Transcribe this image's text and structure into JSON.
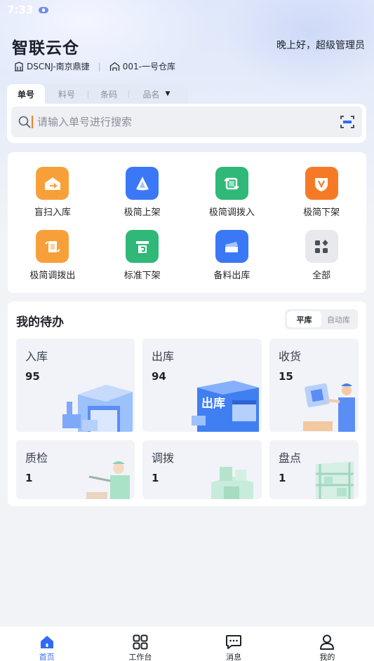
{
  "status_bar": {
    "time": "7:33"
  },
  "header": {
    "app_title": "智联云仓",
    "greeting": "晚上好，超级管理员",
    "company": "DSCNJ-南京鼎捷",
    "warehouse": "001-一号仓库"
  },
  "search": {
    "tabs": [
      {
        "label": "单号",
        "active": true
      },
      {
        "label": "料号",
        "active": false
      },
      {
        "label": "条码",
        "active": false
      },
      {
        "label": "品名",
        "active": false
      }
    ],
    "placeholder": "请输入单号进行搜索"
  },
  "quick_menu": [
    {
      "label": "盲扫入库",
      "icon": "blind-scan-inbound-icon",
      "color": "#f7a03a"
    },
    {
      "label": "极简上架",
      "icon": "simple-shelving-icon",
      "color": "#3a78f6"
    },
    {
      "label": "极简调拨入",
      "icon": "simple-transfer-in-icon",
      "color": "#2fb878"
    },
    {
      "label": "极简下架",
      "icon": "simple-unshelving-icon",
      "color": "#f67a26"
    },
    {
      "label": "极简调拨出",
      "icon": "simple-transfer-out-icon",
      "color": "#f7a03a"
    },
    {
      "label": "标准下架",
      "icon": "standard-unshelving-icon",
      "color": "#2fb878"
    },
    {
      "label": "备料出库",
      "icon": "material-outbound-icon",
      "color": "#3a78f6"
    },
    {
      "label": "全部",
      "icon": "all-apps-icon",
      "color": "#e8e9ed"
    }
  ],
  "todo": {
    "title": "我的待办",
    "segments": [
      {
        "label": "平库",
        "active": true
      },
      {
        "label": "自动库",
        "active": false
      }
    ],
    "tiles": [
      {
        "label": "入库",
        "count": "95"
      },
      {
        "label": "出库",
        "count": "94"
      },
      {
        "label": "收货",
        "count": "15"
      },
      {
        "label": "质检",
        "count": "1"
      },
      {
        "label": "调拨",
        "count": "1"
      },
      {
        "label": "盘点",
        "count": "1"
      }
    ],
    "outbound_art_text": "出库"
  },
  "bottom_nav": [
    {
      "label": "首页",
      "icon": "home-icon",
      "active": true
    },
    {
      "label": "工作台",
      "icon": "workbench-icon",
      "active": false
    },
    {
      "label": "消息",
      "icon": "message-icon",
      "active": false
    },
    {
      "label": "我的",
      "icon": "profile-icon",
      "active": false
    }
  ],
  "colors": {
    "accent": "#2f6bf6",
    "orange": "#f7a03a",
    "green": "#2fb878"
  }
}
